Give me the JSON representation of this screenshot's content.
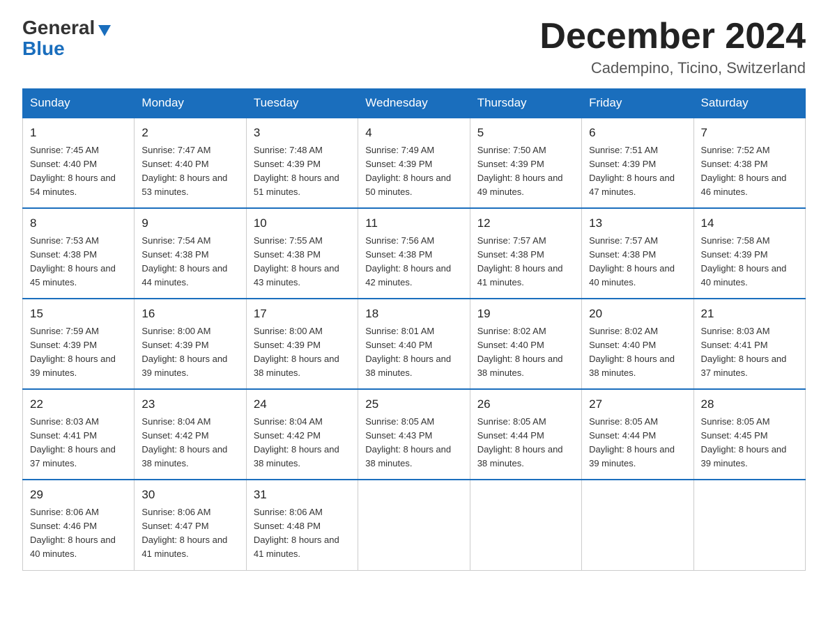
{
  "logo": {
    "general": "General",
    "blue": "Blue",
    "triangle": "▲"
  },
  "header": {
    "month": "December 2024",
    "location": "Cadempino, Ticino, Switzerland"
  },
  "weekdays": [
    "Sunday",
    "Monday",
    "Tuesday",
    "Wednesday",
    "Thursday",
    "Friday",
    "Saturday"
  ],
  "weeks": [
    [
      {
        "day": "1",
        "sunrise": "7:45 AM",
        "sunset": "4:40 PM",
        "daylight": "8 hours and 54 minutes."
      },
      {
        "day": "2",
        "sunrise": "7:47 AM",
        "sunset": "4:40 PM",
        "daylight": "8 hours and 53 minutes."
      },
      {
        "day": "3",
        "sunrise": "7:48 AM",
        "sunset": "4:39 PM",
        "daylight": "8 hours and 51 minutes."
      },
      {
        "day": "4",
        "sunrise": "7:49 AM",
        "sunset": "4:39 PM",
        "daylight": "8 hours and 50 minutes."
      },
      {
        "day": "5",
        "sunrise": "7:50 AM",
        "sunset": "4:39 PM",
        "daylight": "8 hours and 49 minutes."
      },
      {
        "day": "6",
        "sunrise": "7:51 AM",
        "sunset": "4:39 PM",
        "daylight": "8 hours and 47 minutes."
      },
      {
        "day": "7",
        "sunrise": "7:52 AM",
        "sunset": "4:38 PM",
        "daylight": "8 hours and 46 minutes."
      }
    ],
    [
      {
        "day": "8",
        "sunrise": "7:53 AM",
        "sunset": "4:38 PM",
        "daylight": "8 hours and 45 minutes."
      },
      {
        "day": "9",
        "sunrise": "7:54 AM",
        "sunset": "4:38 PM",
        "daylight": "8 hours and 44 minutes."
      },
      {
        "day": "10",
        "sunrise": "7:55 AM",
        "sunset": "4:38 PM",
        "daylight": "8 hours and 43 minutes."
      },
      {
        "day": "11",
        "sunrise": "7:56 AM",
        "sunset": "4:38 PM",
        "daylight": "8 hours and 42 minutes."
      },
      {
        "day": "12",
        "sunrise": "7:57 AM",
        "sunset": "4:38 PM",
        "daylight": "8 hours and 41 minutes."
      },
      {
        "day": "13",
        "sunrise": "7:57 AM",
        "sunset": "4:38 PM",
        "daylight": "8 hours and 40 minutes."
      },
      {
        "day": "14",
        "sunrise": "7:58 AM",
        "sunset": "4:39 PM",
        "daylight": "8 hours and 40 minutes."
      }
    ],
    [
      {
        "day": "15",
        "sunrise": "7:59 AM",
        "sunset": "4:39 PM",
        "daylight": "8 hours and 39 minutes."
      },
      {
        "day": "16",
        "sunrise": "8:00 AM",
        "sunset": "4:39 PM",
        "daylight": "8 hours and 39 minutes."
      },
      {
        "day": "17",
        "sunrise": "8:00 AM",
        "sunset": "4:39 PM",
        "daylight": "8 hours and 38 minutes."
      },
      {
        "day": "18",
        "sunrise": "8:01 AM",
        "sunset": "4:40 PM",
        "daylight": "8 hours and 38 minutes."
      },
      {
        "day": "19",
        "sunrise": "8:02 AM",
        "sunset": "4:40 PM",
        "daylight": "8 hours and 38 minutes."
      },
      {
        "day": "20",
        "sunrise": "8:02 AM",
        "sunset": "4:40 PM",
        "daylight": "8 hours and 38 minutes."
      },
      {
        "day": "21",
        "sunrise": "8:03 AM",
        "sunset": "4:41 PM",
        "daylight": "8 hours and 37 minutes."
      }
    ],
    [
      {
        "day": "22",
        "sunrise": "8:03 AM",
        "sunset": "4:41 PM",
        "daylight": "8 hours and 37 minutes."
      },
      {
        "day": "23",
        "sunrise": "8:04 AM",
        "sunset": "4:42 PM",
        "daylight": "8 hours and 38 minutes."
      },
      {
        "day": "24",
        "sunrise": "8:04 AM",
        "sunset": "4:42 PM",
        "daylight": "8 hours and 38 minutes."
      },
      {
        "day": "25",
        "sunrise": "8:05 AM",
        "sunset": "4:43 PM",
        "daylight": "8 hours and 38 minutes."
      },
      {
        "day": "26",
        "sunrise": "8:05 AM",
        "sunset": "4:44 PM",
        "daylight": "8 hours and 38 minutes."
      },
      {
        "day": "27",
        "sunrise": "8:05 AM",
        "sunset": "4:44 PM",
        "daylight": "8 hours and 39 minutes."
      },
      {
        "day": "28",
        "sunrise": "8:05 AM",
        "sunset": "4:45 PM",
        "daylight": "8 hours and 39 minutes."
      }
    ],
    [
      {
        "day": "29",
        "sunrise": "8:06 AM",
        "sunset": "4:46 PM",
        "daylight": "8 hours and 40 minutes."
      },
      {
        "day": "30",
        "sunrise": "8:06 AM",
        "sunset": "4:47 PM",
        "daylight": "8 hours and 41 minutes."
      },
      {
        "day": "31",
        "sunrise": "8:06 AM",
        "sunset": "4:48 PM",
        "daylight": "8 hours and 41 minutes."
      },
      null,
      null,
      null,
      null
    ]
  ],
  "labels": {
    "sunrise": "Sunrise: ",
    "sunset": "Sunset: ",
    "daylight": "Daylight: "
  }
}
